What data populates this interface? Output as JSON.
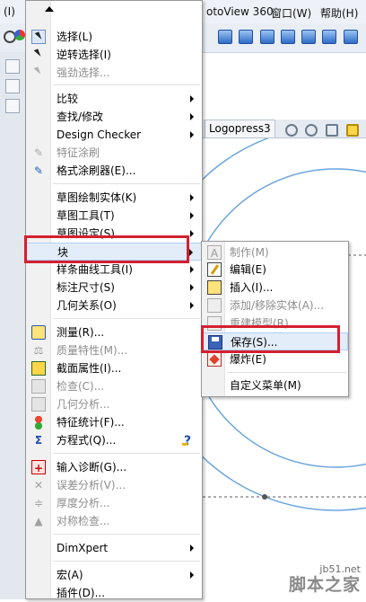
{
  "menubar": {
    "left_fragment": "(I)",
    "items": [
      "otoView 360",
      "窗口(W)",
      "帮助(H)"
    ]
  },
  "tabstrip": {
    "tab": "Logopress3"
  },
  "context_menu": {
    "items": [
      {
        "label": "选择(L)",
        "icon": "select-arrow-icon"
      },
      {
        "label": "逆转选择(I)",
        "icon": "invert-select-icon"
      },
      {
        "label": "强劲选择...",
        "icon": "power-select-icon",
        "disabled": true
      },
      {
        "label": "比较",
        "submenu": true
      },
      {
        "label": "查找/修改",
        "submenu": true
      },
      {
        "label": "Design Checker",
        "submenu": true
      },
      {
        "label": "特征涂刷",
        "icon": "feature-paint-icon",
        "disabled": true
      },
      {
        "label": "格式涂刷器(E)...",
        "icon": "format-painter-icon"
      },
      {
        "label": "草图绘制实体(K)",
        "submenu": true
      },
      {
        "label": "草图工具(T)",
        "submenu": true
      },
      {
        "label": "草图设定(S)",
        "submenu": true
      },
      {
        "label": "块",
        "submenu": true,
        "hover": true
      },
      {
        "label": "样条曲线工具(I)",
        "submenu": true
      },
      {
        "label": "标注尺寸(S)",
        "submenu": true
      },
      {
        "label": "几何关系(O)",
        "submenu": true
      },
      {
        "label": "测量(R)...",
        "icon": "measure-icon"
      },
      {
        "label": "质量特性(M)...",
        "icon": "mass-properties-icon",
        "disabled": true
      },
      {
        "label": "截面属性(I)...",
        "icon": "section-properties-icon"
      },
      {
        "label": "检查(C)...",
        "icon": "check-icon",
        "disabled": true
      },
      {
        "label": "几何分析...",
        "icon": "geometry-analysis-icon",
        "disabled": true
      },
      {
        "label": "特征统计(F)...",
        "icon": "feature-statistics-icon"
      },
      {
        "label": "方程式(Q)...",
        "icon": "equation-sigma-icon"
      },
      {
        "label": "输入诊断(G)...",
        "icon": "import-diagnostics-icon"
      },
      {
        "label": "误差分析(V)...",
        "icon": "deviation-analysis-icon",
        "disabled": true
      },
      {
        "label": "厚度分析...",
        "icon": "thickness-analysis-icon",
        "disabled": true
      },
      {
        "label": "对称检查...",
        "icon": "symmetry-check-icon",
        "disabled": true
      },
      {
        "label": "DimXpert",
        "submenu": true
      },
      {
        "label": "宏(A)",
        "submenu": true
      },
      {
        "label": "插件(D)..."
      }
    ]
  },
  "block_submenu": {
    "items": [
      {
        "label": "制作(M)",
        "disabled": true
      },
      {
        "label": "编辑(E)"
      },
      {
        "label": "插入(I)..."
      },
      {
        "label": "添加/移除实体(A)...",
        "disabled": true
      },
      {
        "label": "重建模型(R)",
        "disabled": true
      },
      {
        "label": "保存(S)..."
      },
      {
        "label": "爆炸(E)"
      },
      {
        "label": "自定义菜单(M)"
      }
    ]
  },
  "watermark": {
    "site": "jb51.net",
    "name": "脚本之家"
  },
  "colors": {
    "highlight_box": "#d42030",
    "hover_bg": "#e3edfa",
    "disabled_text": "#8d8d8d",
    "canvas_circle": "#6aa6de"
  }
}
